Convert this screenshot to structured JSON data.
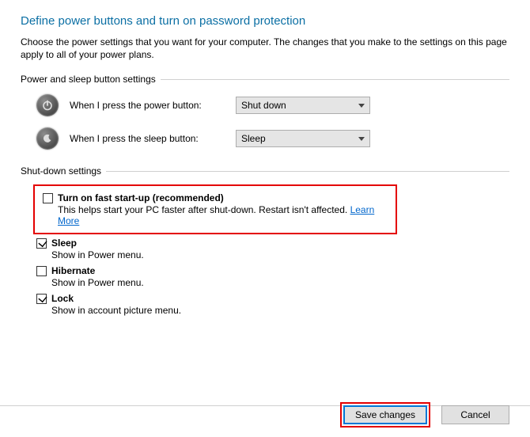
{
  "title": "Define power buttons and turn on password protection",
  "description": "Choose the power settings that you want for your computer. The changes that you make to the settings on this page apply to all of your power plans.",
  "group1": {
    "header": "Power and sleep button settings",
    "rows": [
      {
        "label": "When I press the power button:",
        "value": "Shut down"
      },
      {
        "label": "When I press the sleep button:",
        "value": "Sleep"
      }
    ]
  },
  "group2": {
    "header": "Shut-down settings",
    "items": [
      {
        "checked": false,
        "title": "Turn on fast start-up (recommended)",
        "sub": "This helps start your PC faster after shut-down. Restart isn't affected. ",
        "link": "Learn More"
      },
      {
        "checked": true,
        "title": "Sleep",
        "sub": "Show in Power menu."
      },
      {
        "checked": false,
        "title": "Hibernate",
        "sub": "Show in Power menu."
      },
      {
        "checked": true,
        "title": "Lock",
        "sub": "Show in account picture menu."
      }
    ]
  },
  "footer": {
    "save": "Save changes",
    "cancel": "Cancel"
  }
}
